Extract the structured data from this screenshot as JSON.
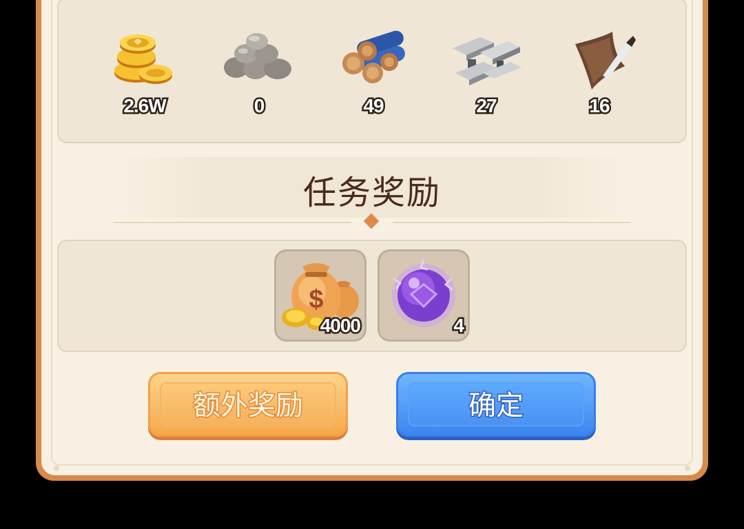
{
  "resources": [
    {
      "icon": "gold-coins-icon",
      "value": "2.6W"
    },
    {
      "icon": "stone-pile-icon",
      "value": "0"
    },
    {
      "icon": "wood-logs-icon",
      "value": "49"
    },
    {
      "icon": "iron-ingot-icon",
      "value": "27"
    },
    {
      "icon": "leather-hide-icon",
      "value": "16"
    }
  ],
  "section_title": "任务奖励",
  "rewards": [
    {
      "icon": "money-bag-icon",
      "count": "4000"
    },
    {
      "icon": "purple-orb-icon",
      "count": "4"
    }
  ],
  "buttons": {
    "bonus_label": "额外奖励",
    "confirm_label": "确定"
  },
  "colors": {
    "frame": "#d68a4c",
    "background": "#f8f1e3",
    "bonus_button": "#f6a84a",
    "confirm_button": "#3d86ef",
    "title_text": "#4a2a1e"
  }
}
